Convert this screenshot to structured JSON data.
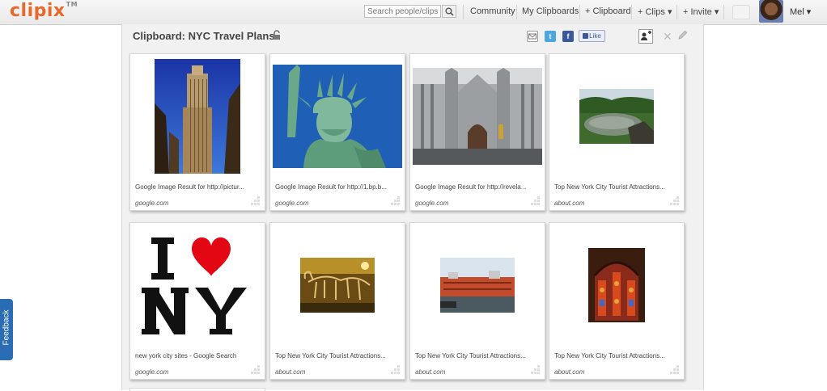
{
  "header": {
    "logo": "clipix",
    "logo_mark": "TM",
    "search_placeholder": "Search people/clips",
    "nav": [
      "Community",
      "My Clipboards",
      "+ Clipboard",
      "+ Clips ▾",
      "+ Invite ▾"
    ],
    "user_name": "Mel ▾"
  },
  "clipboard": {
    "title": "Clipboard: NYC Travel Plans",
    "like_label": "Like"
  },
  "cards": [
    {
      "title": "Google Image Result for http://pictur...",
      "source": "google.com"
    },
    {
      "title": "Google Image Result for http://1.bp.b...",
      "source": "google.com"
    },
    {
      "title": "Google Image Result for http://revela...",
      "source": "google.com"
    },
    {
      "title": "Top New York City Tourist Attractions...",
      "source": "about.com"
    },
    {
      "title": "new york city sites - Google Search",
      "source": "google.com"
    },
    {
      "title": "Top New York City Tourist Attractions...",
      "source": "about.com"
    },
    {
      "title": "Top New York City Tourist Attractions...",
      "source": "about.com"
    },
    {
      "title": "Top New York City Tourist Attractions...",
      "source": "about.com"
    }
  ],
  "feedback": "Feedback",
  "colors": {
    "brand": "#e8692c",
    "feedback": "#2a6db5",
    "facebook": "#3b5998",
    "twitter": "#4aa7e0"
  }
}
